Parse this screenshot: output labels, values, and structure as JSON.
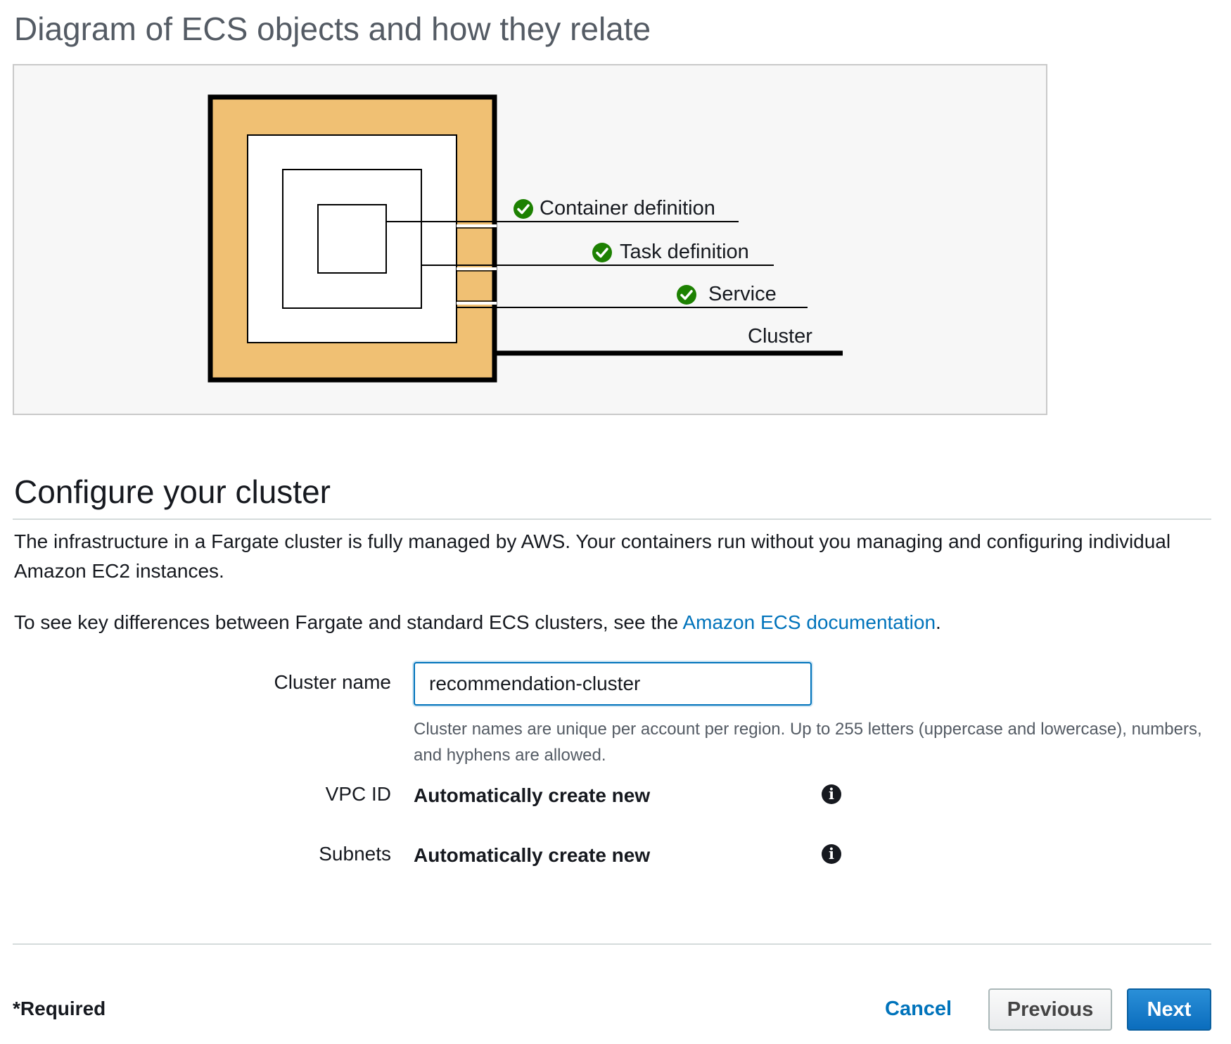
{
  "diagram": {
    "title": "Diagram of ECS objects and how they relate",
    "labels": {
      "container": "Container definition",
      "task": "Task definition",
      "service": "Service",
      "cluster": "Cluster"
    },
    "colors": {
      "cluster_fill": "#f0c073",
      "check": "#1d8102"
    }
  },
  "configure": {
    "title": "Configure your cluster",
    "intro": "The infrastructure in a Fargate cluster is fully managed by AWS. Your containers run without you managing and configuring individual Amazon EC2 instances.",
    "docs_prefix": "To see key differences between Fargate and standard ECS clusters, see the ",
    "docs_link": "Amazon ECS documentation",
    "docs_suffix": "."
  },
  "form": {
    "cluster_name": {
      "label": "Cluster name",
      "value": "recommendation-cluster",
      "hint": "Cluster names are unique per account per region. Up to 255 letters (uppercase and lowercase), numbers, and hyphens are allowed."
    },
    "vpc": {
      "label": "VPC ID",
      "value": "Automatically create new",
      "icon": "info-icon"
    },
    "subnets": {
      "label": "Subnets",
      "value": "Automatically create new",
      "icon": "info-icon"
    }
  },
  "footer": {
    "required": "*Required",
    "cancel": "Cancel",
    "previous": "Previous",
    "next": "Next"
  }
}
